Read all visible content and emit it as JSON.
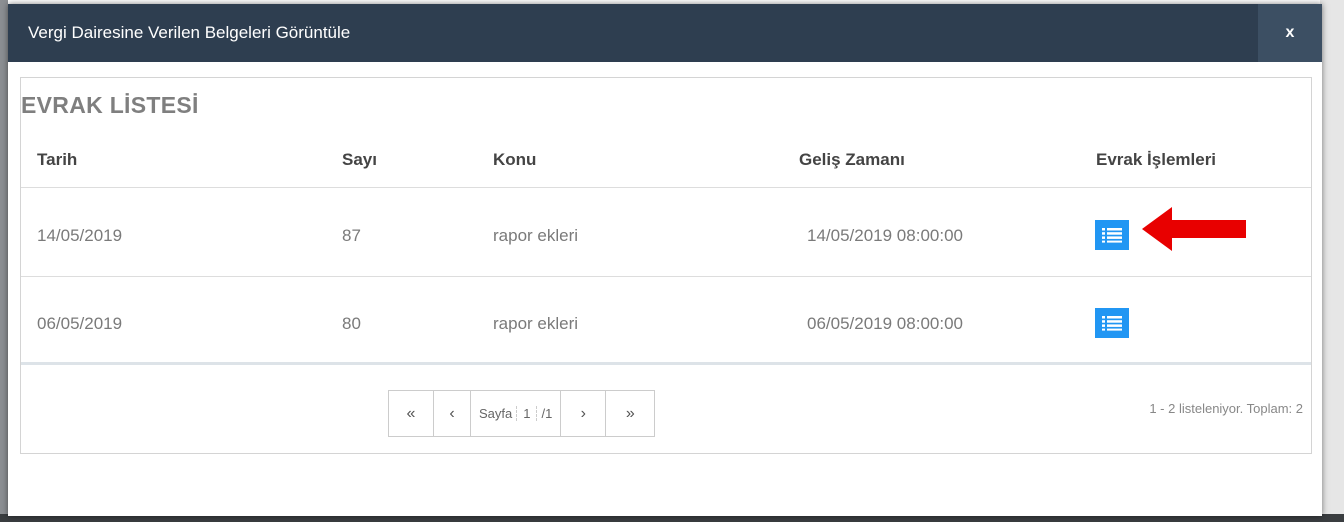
{
  "modal": {
    "title": "Vergi Dairesine Verilen Belgeleri Görüntüle",
    "close_label": "x"
  },
  "panel": {
    "title": "EVRAK LİSTESİ",
    "columns": [
      "Tarih",
      "Sayı",
      "Konu",
      "Geliş Zamanı",
      "Evrak İşlemleri"
    ],
    "rows": [
      {
        "tarih": "14/05/2019",
        "sayi": "87",
        "konu": "rapor ekleri",
        "gelis": "14/05/2019 08:00:00",
        "action_icon": "list-icon"
      },
      {
        "tarih": "06/05/2019",
        "sayi": "80",
        "konu": "rapor ekleri",
        "gelis": "06/05/2019 08:00:00",
        "action_icon": "list-icon"
      }
    ]
  },
  "pagination": {
    "first": "«",
    "prev": "‹",
    "page_label": "Sayfa",
    "current": "1",
    "total": "/1",
    "next": "›",
    "last": "»",
    "info": "1 - 2 listeleniyor. Toplam: 2"
  },
  "colors": {
    "header_bg": "#2e3e50",
    "action_button": "#2196f3",
    "annotation_arrow": "#e80000"
  }
}
